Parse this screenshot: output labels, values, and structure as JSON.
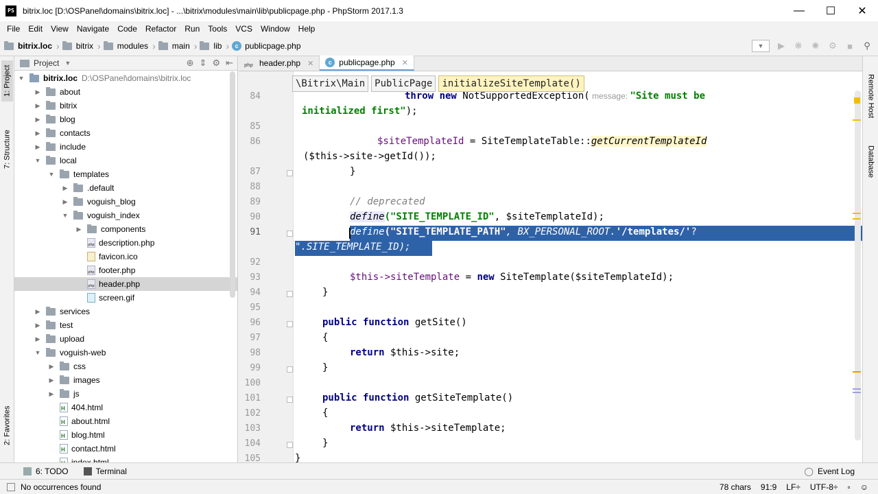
{
  "window": {
    "title": "bitrix.loc [D:\\OSPanel\\domains\\bitrix.loc] - ...\\bitrix\\modules\\main\\lib\\publicpage.php - PhpStorm 2017.1.3",
    "app_icon": "PS"
  },
  "menu": [
    "File",
    "Edit",
    "View",
    "Navigate",
    "Code",
    "Refactor",
    "Run",
    "Tools",
    "VCS",
    "Window",
    "Help"
  ],
  "nav_crumbs": [
    "bitrix.loc",
    "bitrix",
    "modules",
    "main",
    "lib",
    "publicpage.php"
  ],
  "left_tabs": [
    "1: Project",
    "7: Structure",
    "2: Favorites"
  ],
  "right_tabs": [
    "Remote Host",
    "Database"
  ],
  "project": {
    "header": "Project",
    "root_name": "bitrix.loc",
    "root_path": "D:\\OSPanel\\domains\\bitrix.loc",
    "items": [
      {
        "label": "about",
        "type": "folder",
        "depth": 1,
        "arrow": "right"
      },
      {
        "label": "bitrix",
        "type": "folder",
        "depth": 1,
        "arrow": "right"
      },
      {
        "label": "blog",
        "type": "folder",
        "depth": 1,
        "arrow": "right"
      },
      {
        "label": "contacts",
        "type": "folder",
        "depth": 1,
        "arrow": "right"
      },
      {
        "label": "include",
        "type": "folder",
        "depth": 1,
        "arrow": "right"
      },
      {
        "label": "local",
        "type": "folder",
        "depth": 1,
        "arrow": "down"
      },
      {
        "label": "templates",
        "type": "folder",
        "depth": 2,
        "arrow": "down"
      },
      {
        "label": ".default",
        "type": "folder",
        "depth": 3,
        "arrow": "right"
      },
      {
        "label": "voguish_blog",
        "type": "folder",
        "depth": 3,
        "arrow": "right"
      },
      {
        "label": "voguish_index",
        "type": "folder",
        "depth": 3,
        "arrow": "down"
      },
      {
        "label": "components",
        "type": "folder",
        "depth": 4,
        "arrow": "right"
      },
      {
        "label": "description.php",
        "type": "php",
        "depth": 4,
        "arrow": "none"
      },
      {
        "label": "favicon.ico",
        "type": "ico",
        "depth": 4,
        "arrow": "none"
      },
      {
        "label": "footer.php",
        "type": "php",
        "depth": 4,
        "arrow": "none"
      },
      {
        "label": "header.php",
        "type": "php",
        "depth": 4,
        "arrow": "none",
        "selected": true
      },
      {
        "label": "screen.gif",
        "type": "gif",
        "depth": 4,
        "arrow": "none"
      },
      {
        "label": "services",
        "type": "folder",
        "depth": 1,
        "arrow": "right"
      },
      {
        "label": "test",
        "type": "folder",
        "depth": 1,
        "arrow": "right"
      },
      {
        "label": "upload",
        "type": "folder",
        "depth": 1,
        "arrow": "right"
      },
      {
        "label": "voguish-web",
        "type": "folder",
        "depth": 1,
        "arrow": "down"
      },
      {
        "label": "css",
        "type": "folder",
        "depth": 2,
        "arrow": "right"
      },
      {
        "label": "images",
        "type": "folder",
        "depth": 2,
        "arrow": "right"
      },
      {
        "label": "js",
        "type": "folder",
        "depth": 2,
        "arrow": "right"
      },
      {
        "label": "404.html",
        "type": "html",
        "depth": 2,
        "arrow": "none"
      },
      {
        "label": "about.html",
        "type": "html",
        "depth": 2,
        "arrow": "none"
      },
      {
        "label": "blog.html",
        "type": "html",
        "depth": 2,
        "arrow": "none"
      },
      {
        "label": "contact.html",
        "type": "html",
        "depth": 2,
        "arrow": "none"
      },
      {
        "label": "index.html",
        "type": "html",
        "depth": 2,
        "arrow": "none"
      }
    ]
  },
  "editor_tabs": [
    {
      "label": "header.php",
      "kind": "php",
      "active": false
    },
    {
      "label": "publicpage.php",
      "kind": "class",
      "active": true
    }
  ],
  "editor_breadcrumb": [
    "\\Bitrix\\Main",
    "PublicPage",
    "initializeSiteTemplate()"
  ],
  "line_numbers": [
    "84",
    "85",
    "86",
    "87",
    "88",
    "89",
    "90",
    "91",
    "92",
    "93",
    "94",
    "95",
    "96",
    "97",
    "98",
    "99",
    "100",
    "101",
    "102",
    "103",
    "104",
    "105"
  ],
  "code": {
    "l84_kw": "throw new",
    "l84_cls": " NotSupportedException(",
    "l84_hint": " message: ",
    "l84_str": "\"Site must be",
    "l84b_str": "initialized first\"",
    "l84b_end": ");",
    "l86_var": "$siteTemplateId",
    "l86_mid": " = SiteTemplateTable::",
    "l86_fn": "getCurrentTemplateId",
    "l86b": "($this->site->getId());",
    "l87": "}",
    "l89_cmt": "// deprecated",
    "l90_fn": "define",
    "l90_str": "(\"SITE_TEMPLATE_ID\"",
    "l90_rest": ", $siteTemplateId);",
    "l91_fn": "define",
    "l91_str": "(\"SITE_TEMPLATE_PATH\"",
    "l91_mid": ", BX_PERSONAL_ROOT.",
    "l91_str2": "'/templates/'",
    "l91_end": "?",
    "l91b": "\".SITE_TEMPLATE_ID);",
    "l93_var": "$this->siteTemplate",
    "l93_mid": " = ",
    "l93_kw": "new",
    "l93_rest": " SiteTemplate($siteTemplateId);",
    "l94": "}",
    "l96_kw": "public function",
    "l96_rest": " getSite()",
    "l97": "{",
    "l98_kw": "return",
    "l98_rest": " $this->site;",
    "l99": "}",
    "l101_kw": "public function",
    "l101_rest": " getSiteTemplate()",
    "l102": "{",
    "l103_kw": "return",
    "l103_rest": " $this->siteTemplate;",
    "l104": "}",
    "l105": "}"
  },
  "bottom_tools": [
    {
      "label": "6: TODO"
    },
    {
      "label": "Terminal"
    }
  ],
  "event_log": "Event Log",
  "status": {
    "message": "No occurrences found",
    "chars": "78 chars",
    "position": "91:9",
    "line_sep": "LF÷",
    "encoding": "UTF-8÷"
  },
  "colors": {
    "selection": "#2e62a8",
    "keyword": "#000080",
    "string": "#008000",
    "variable": "#660e7a",
    "comment": "#808080"
  }
}
